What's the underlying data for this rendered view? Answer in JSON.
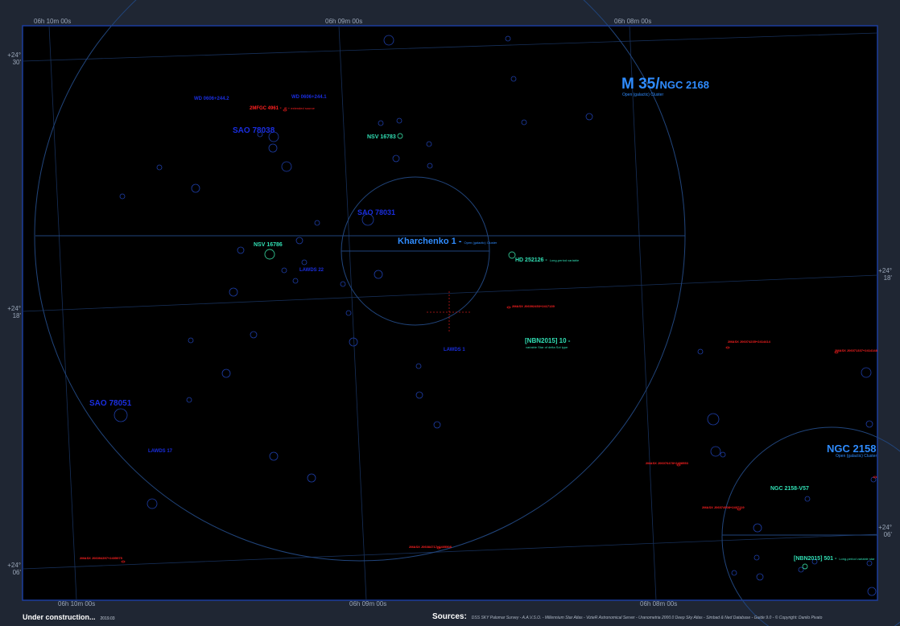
{
  "ra_axis": {
    "top": [
      "06h 10m 00s",
      "06h 09m 00s",
      "06h 08m 00s"
    ],
    "bottom": [
      "06h 10m 00s",
      "06h 09m 00s",
      "06h 08m 00s"
    ]
  },
  "dec_axis": {
    "left": [
      "+24°\n30'",
      "+24°\n18'",
      "+24°\n06'"
    ],
    "right": [
      "+24°\n18'",
      "+24°\n06'"
    ]
  },
  "clusters": {
    "m35": {
      "name": "M 35",
      "alt": "NGC 2168",
      "type": "Open (galactic) Cluster"
    },
    "ngc2158": {
      "name": "NGC 2158",
      "type": "Open (galactic) Cluster"
    }
  },
  "objects": [
    {
      "id": "kharchenko",
      "label": "Kharchenko 1",
      "sub": "Open (galactic) Cluster"
    },
    {
      "id": "sao78031",
      "label": "SAO 78031"
    },
    {
      "id": "sao78038",
      "label": "SAO 78038"
    },
    {
      "id": "sao78051",
      "label": "SAO 78051"
    },
    {
      "id": "wd1",
      "label": "WD 0606+244.2"
    },
    {
      "id": "wd2",
      "label": "WD 0606+244.1"
    },
    {
      "id": "2mfgc",
      "label": "2MFGC 4961",
      "sub": "IR + extended source"
    },
    {
      "id": "nsv16783",
      "label": "NSV 16783"
    },
    {
      "id": "nsv16786",
      "label": "NSV 16786"
    },
    {
      "id": "hd252126",
      "label": "HD 252126",
      "sub": "Long-period variable"
    },
    {
      "id": "lawds22",
      "label": "LAWDS 22"
    },
    {
      "id": "lawds1",
      "label": "LAWDS 1"
    },
    {
      "id": "lawds17",
      "label": "LAWDS 17"
    },
    {
      "id": "nbn10",
      "label": "[NBN2015] 10",
      "sub": "variable Star of delta Sct type"
    },
    {
      "id": "ngcv57",
      "label": "NGC 2158-V57"
    },
    {
      "id": "nbn501",
      "label": "[NBN2015] 501",
      "sub": "Long-period variable star"
    },
    {
      "id": "2m_a",
      "label": "2MASX J06092453+2417139"
    },
    {
      "id": "2m_b",
      "label": "2MASX J06074235+2414414"
    },
    {
      "id": "2m_c",
      "label": "2MASX J06071337+2414148"
    },
    {
      "id": "2m_d",
      "label": "2MASX J06076478+2408553"
    },
    {
      "id": "2m_e",
      "label": "2MASX J06074908+2407119"
    },
    {
      "id": "2m_f",
      "label": "2MASX J06084717+2405508"
    },
    {
      "id": "2m_g",
      "label": "2MASX J06094397+2405975"
    }
  ],
  "footer": {
    "status": "Under construction...",
    "date": "2019.03",
    "sources_label": "Sources:",
    "sources_text": "DSS SKY Palomar Survey - A.A.V.S.O. - Millennium Star Atlas - VizieR Astronomical Server - Uranometria 2000.0 Deep Sky Atlas - Simbad & Ned Database - Guide 9.0 - © Copyright: Danilo Pivato"
  },
  "colors": {
    "background": "#000000",
    "frame": "#1f2633",
    "grid": "#17305a",
    "circle": "#21457c",
    "cluster_label": "#2f8cff",
    "star_label": "#1a2ee0",
    "variable_label": "#31e0b5",
    "galaxy_label": "#ff2020",
    "star_outline": "#1e3ea8"
  }
}
